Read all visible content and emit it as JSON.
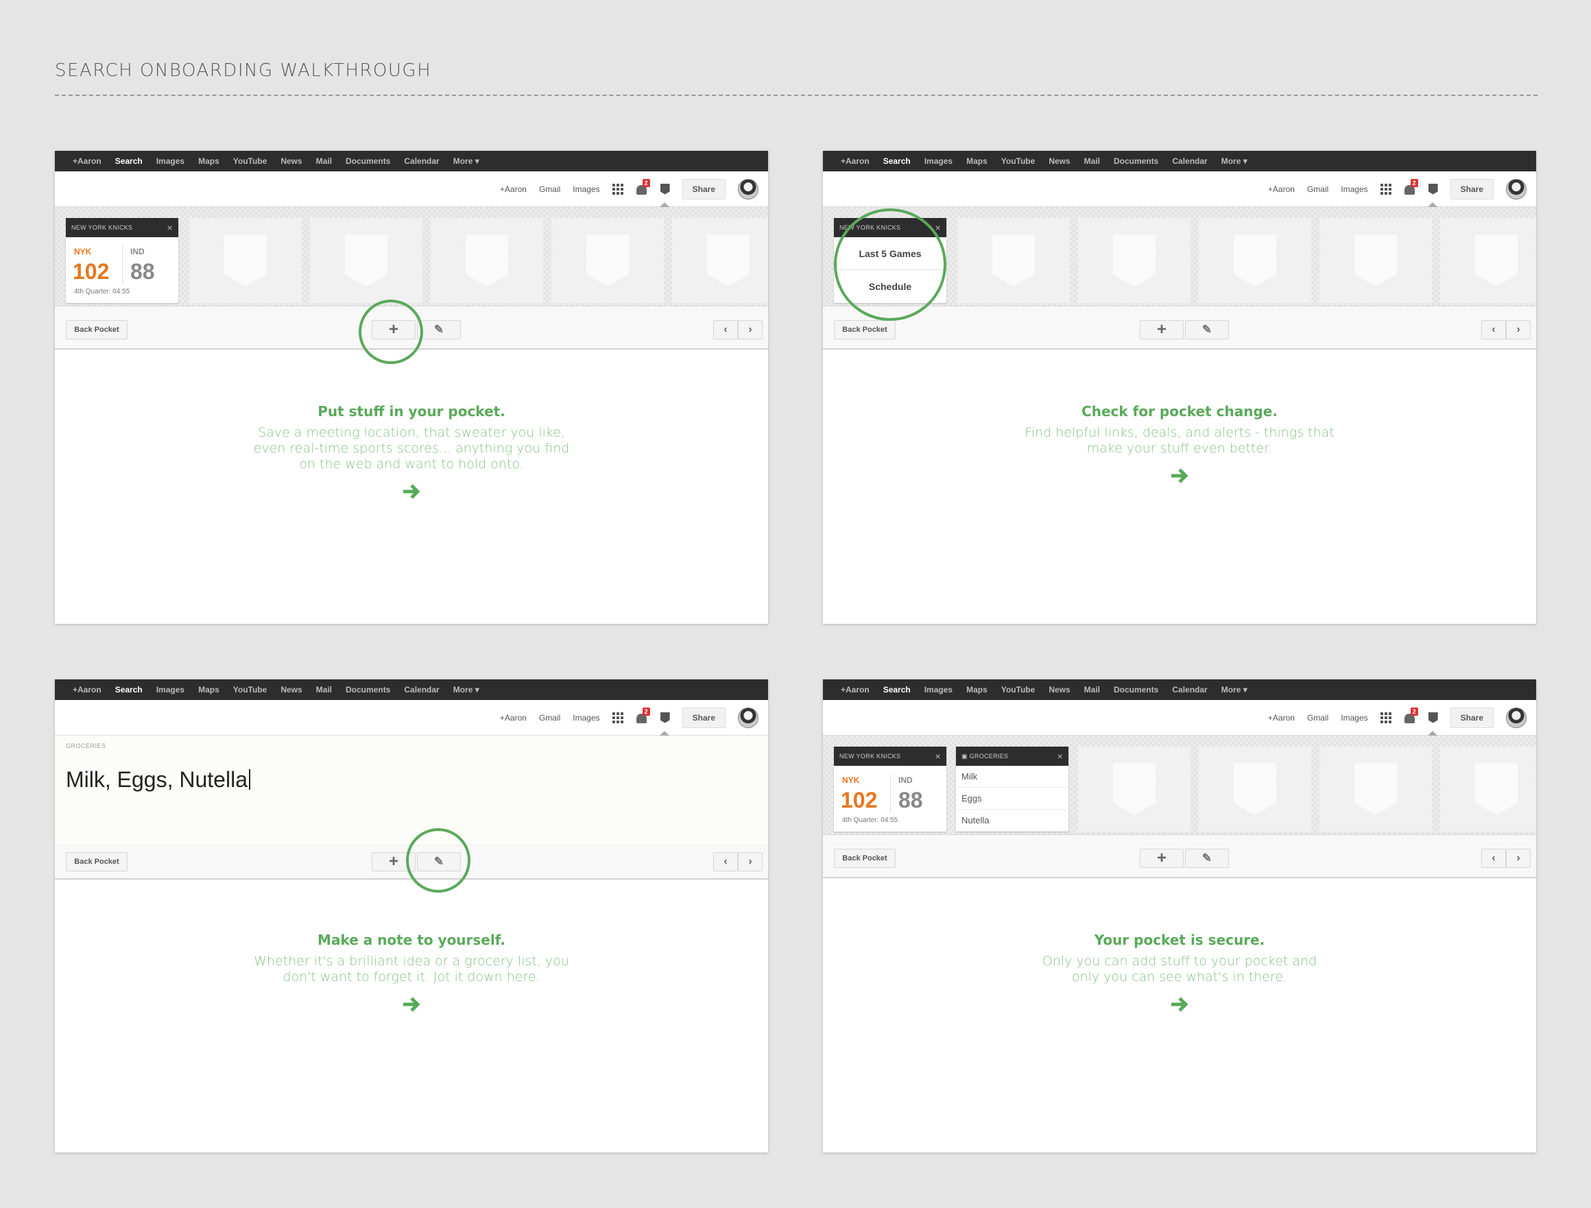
{
  "page_title": "SEARCH ONBOARDING WALKTHROUGH",
  "nav": [
    "+Aaron",
    "Search",
    "Images",
    "Maps",
    "YouTube",
    "News",
    "Mail",
    "Documents",
    "Calendar",
    "More ▾"
  ],
  "nav_active": "Search",
  "topbar": {
    "links": [
      "+Aaron",
      "Gmail",
      "Images"
    ],
    "notif_count": "2",
    "share": "Share"
  },
  "toolbar": {
    "back_pocket": "Back Pocket"
  },
  "score_card": {
    "title": "NEW YORK KNICKS",
    "home": "NYK",
    "home_score": "102",
    "away": "IND",
    "away_score": "88",
    "status": "4th Quarter: 04:55"
  },
  "menu": {
    "item1": "Last 5 Games",
    "item2": "Schedule"
  },
  "note": {
    "label": "GROCERIES",
    "text": "Milk, Eggs, Nutella"
  },
  "groceries": {
    "title": "GROCERIES",
    "items": [
      "Milk",
      "Eggs",
      "Nutella"
    ]
  },
  "steps": [
    {
      "heading": "Put stuff in your pocket.",
      "lines": [
        "Save a meeting location, that sweater you like,",
        "even real-time sports scores... anything you find",
        "on the web and want to hold onto."
      ]
    },
    {
      "heading": "Check for pocket change.",
      "lines": [
        "Find helpful links, deals, and alerts - things that",
        "make your stuff even better."
      ]
    },
    {
      "heading": "Make a note to yourself.",
      "lines": [
        "Whether it's a brilliant idea or a grocery list,  you",
        "don't want to forget it. Jot it down here."
      ]
    },
    {
      "heading": "Your pocket is secure.",
      "lines": [
        "Only you can add stuff to your pocket and",
        "only you can see what's in there."
      ]
    }
  ],
  "colors": {
    "accent_green": "#5aa95a",
    "home_team_orange": "#e8761e",
    "dark_bar": "#2d2d2d",
    "badge_red": "#d33333"
  }
}
